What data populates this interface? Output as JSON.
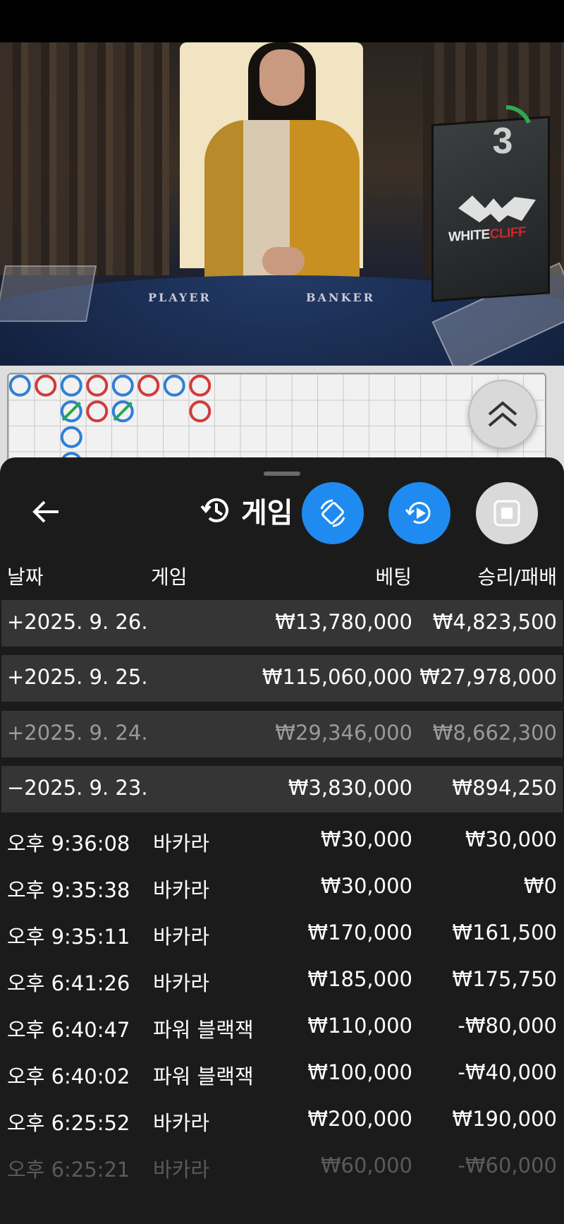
{
  "video": {
    "table_labels": {
      "player": "PLAYER",
      "banker": "BANKER"
    },
    "brand": {
      "part1": "WHITE",
      "part2": "CLIFF"
    },
    "timer": "3",
    "timer_color": "#2fa84f"
  },
  "roadmap": {
    "colors": {
      "player": "#2f7fd8",
      "banker": "#d33a3a",
      "tie": "#23a847"
    }
  },
  "sheet": {
    "title": "게임",
    "back_icon": "arrow-left-icon",
    "history_icon": "history-icon",
    "buttons": [
      {
        "icon": "rotate-phone-icon",
        "color": "#1f8bf0"
      },
      {
        "icon": "replay-icon",
        "color": "#1f8bf0"
      },
      {
        "icon": "stop-icon",
        "color": "#d9d9d9"
      }
    ]
  },
  "columns": {
    "date": "날짜",
    "game": "게임",
    "bet": "베팅",
    "result": "승리/패배"
  },
  "days": [
    {
      "date": "+2025. 9. 26.",
      "bet": "₩13,780,000",
      "result": "₩4,823,500"
    },
    {
      "date": "+2025. 9. 25.",
      "bet": "₩115,060,000",
      "result": "₩27,978,000"
    },
    {
      "date": "+2025. 9. 24.",
      "bet": "₩29,346,000",
      "result": "₩8,662,300"
    },
    {
      "date": "−2025. 9. 23.",
      "bet": "₩3,830,000",
      "result": "₩894,250"
    }
  ],
  "transactions": [
    {
      "time": "오후 9:36:08",
      "game": "바카라",
      "bet": "₩30,000",
      "result": "₩30,000"
    },
    {
      "time": "오후 9:35:38",
      "game": "바카라",
      "bet": "₩30,000",
      "result": "₩0"
    },
    {
      "time": "오후 9:35:11",
      "game": "바카라",
      "bet": "₩170,000",
      "result": "₩161,500"
    },
    {
      "time": "오후 6:41:26",
      "game": "바카라",
      "bet": "₩185,000",
      "result": "₩175,750"
    },
    {
      "time": "오후 6:40:47",
      "game": "파워 블랙잭",
      "bet": "₩110,000",
      "result": "-₩80,000"
    },
    {
      "time": "오후 6:40:02",
      "game": "파워 블랙잭",
      "bet": "₩100,000",
      "result": "-₩40,000"
    },
    {
      "time": "오후 6:25:52",
      "game": "바카라",
      "bet": "₩200,000",
      "result": "₩190,000"
    },
    {
      "time": "오후 6:25:21",
      "game": "바카라",
      "bet": "₩60,000",
      "result": "-₩60,000"
    }
  ]
}
